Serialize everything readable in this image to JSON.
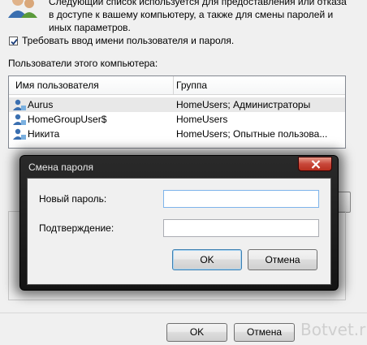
{
  "description": {
    "line1": "Следующий список используется для предоставления или отказа",
    "line2": "в доступе к вашему компьютеру, а также для смены паролей и",
    "line3": "иных параметров."
  },
  "require_password": {
    "checked": true,
    "label": "Требовать ввод имени пользователя и пароля."
  },
  "users_section_label": "Пользователи этого компьютера:",
  "users_table": {
    "columns": [
      "Имя пользователя",
      "Группа"
    ],
    "rows": [
      {
        "name": "Aurus",
        "group": "HomeUsers; Администраторы",
        "selected": true
      },
      {
        "name": "HomeGroupUser$",
        "group": "HomeUsers",
        "selected": false
      },
      {
        "name": "Никита",
        "group": "HomeUsers; Опытные пользова...",
        "selected": false
      }
    ]
  },
  "main_buttons": {
    "ok": "OK",
    "cancel": "Отмена"
  },
  "watermark": "Botvet.ru",
  "password_dialog": {
    "title": "Смена пароля",
    "new_password_label": "Новый пароль:",
    "new_password_value": "",
    "confirm_label": "Подтверждение:",
    "confirm_value": "",
    "ok": "OK",
    "cancel": "Отмена"
  },
  "colors": {
    "dialog_frame": "#1a1a1a",
    "close_button": "#c8473a",
    "selected_row": "#e8e8e8"
  }
}
